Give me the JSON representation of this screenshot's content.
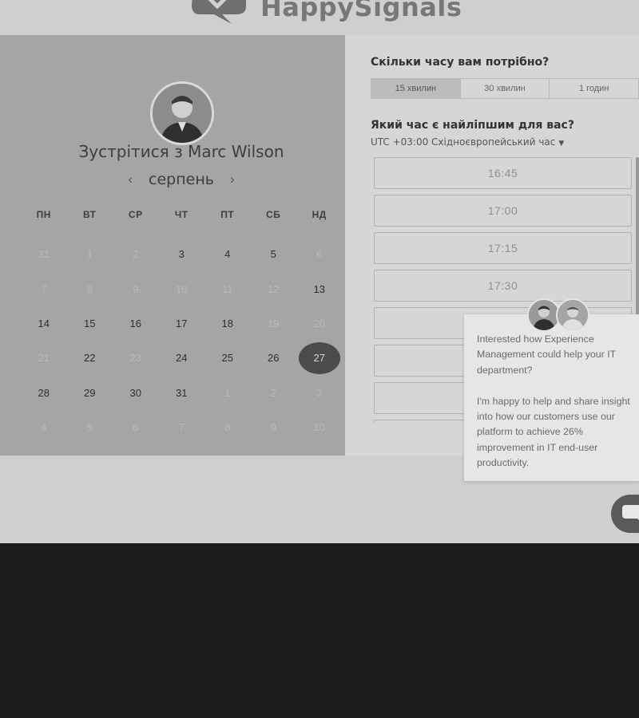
{
  "brand": {
    "name": "HappySignals",
    "logo_icon": "speech-bubble-check-icon"
  },
  "host": {
    "meet_title": "Зустрітися з Marc Wilson",
    "avatar": "host-avatar"
  },
  "calendar": {
    "month": "серпень",
    "prev_icon": "chevron-left-icon",
    "next_icon": "chevron-right-icon",
    "weekdays": [
      "ПН",
      "ВТ",
      "СР",
      "ЧТ",
      "ПТ",
      "СБ",
      "НД"
    ],
    "weeks": [
      [
        "31",
        "1",
        "2",
        "3",
        "4",
        "5",
        "6"
      ],
      [
        "7",
        "8",
        "9",
        "10",
        "11",
        "12",
        "13"
      ],
      [
        "14",
        "15",
        "16",
        "17",
        "18",
        "19",
        "20"
      ],
      [
        "21",
        "22",
        "23",
        "24",
        "25",
        "26",
        "27"
      ],
      [
        "28",
        "29",
        "30",
        "31",
        "1",
        "2",
        "3"
      ],
      [
        "4",
        "5",
        "6",
        "7",
        "8",
        "9",
        "10"
      ]
    ],
    "available": [
      [
        false,
        false,
        false,
        true,
        true,
        true,
        false
      ],
      [
        false,
        false,
        false,
        false,
        false,
        false,
        true
      ],
      [
        true,
        true,
        true,
        true,
        true,
        false,
        false
      ],
      [
        false,
        true,
        false,
        true,
        true,
        true,
        true
      ],
      [
        true,
        true,
        true,
        true,
        false,
        false,
        false
      ],
      [
        false,
        false,
        false,
        false,
        false,
        false,
        false
      ]
    ],
    "selected": "27"
  },
  "booking": {
    "duration_question": "Скільки часу вам потрібно?",
    "durations": [
      "15 хвилин",
      "30 хвилин",
      "1 годин"
    ],
    "selected_duration": "15 хвилин",
    "time_question": "Який час є найліпшим для вас?",
    "timezone": "UTC +03:00 Східноєвропейський час",
    "timezone_icon": "caret-down-icon",
    "slots": [
      "16:45",
      "17:00",
      "17:15",
      "17:30",
      "",
      "",
      "",
      ""
    ]
  },
  "chat": {
    "message": "Interested how Experience Management could help your IT department?\n\nI'm happy to help and share insight into how our customers use our platform to achieve 26% improvement in IT end-user productivity.",
    "launcher_icon": "chat-bubble-icon"
  }
}
